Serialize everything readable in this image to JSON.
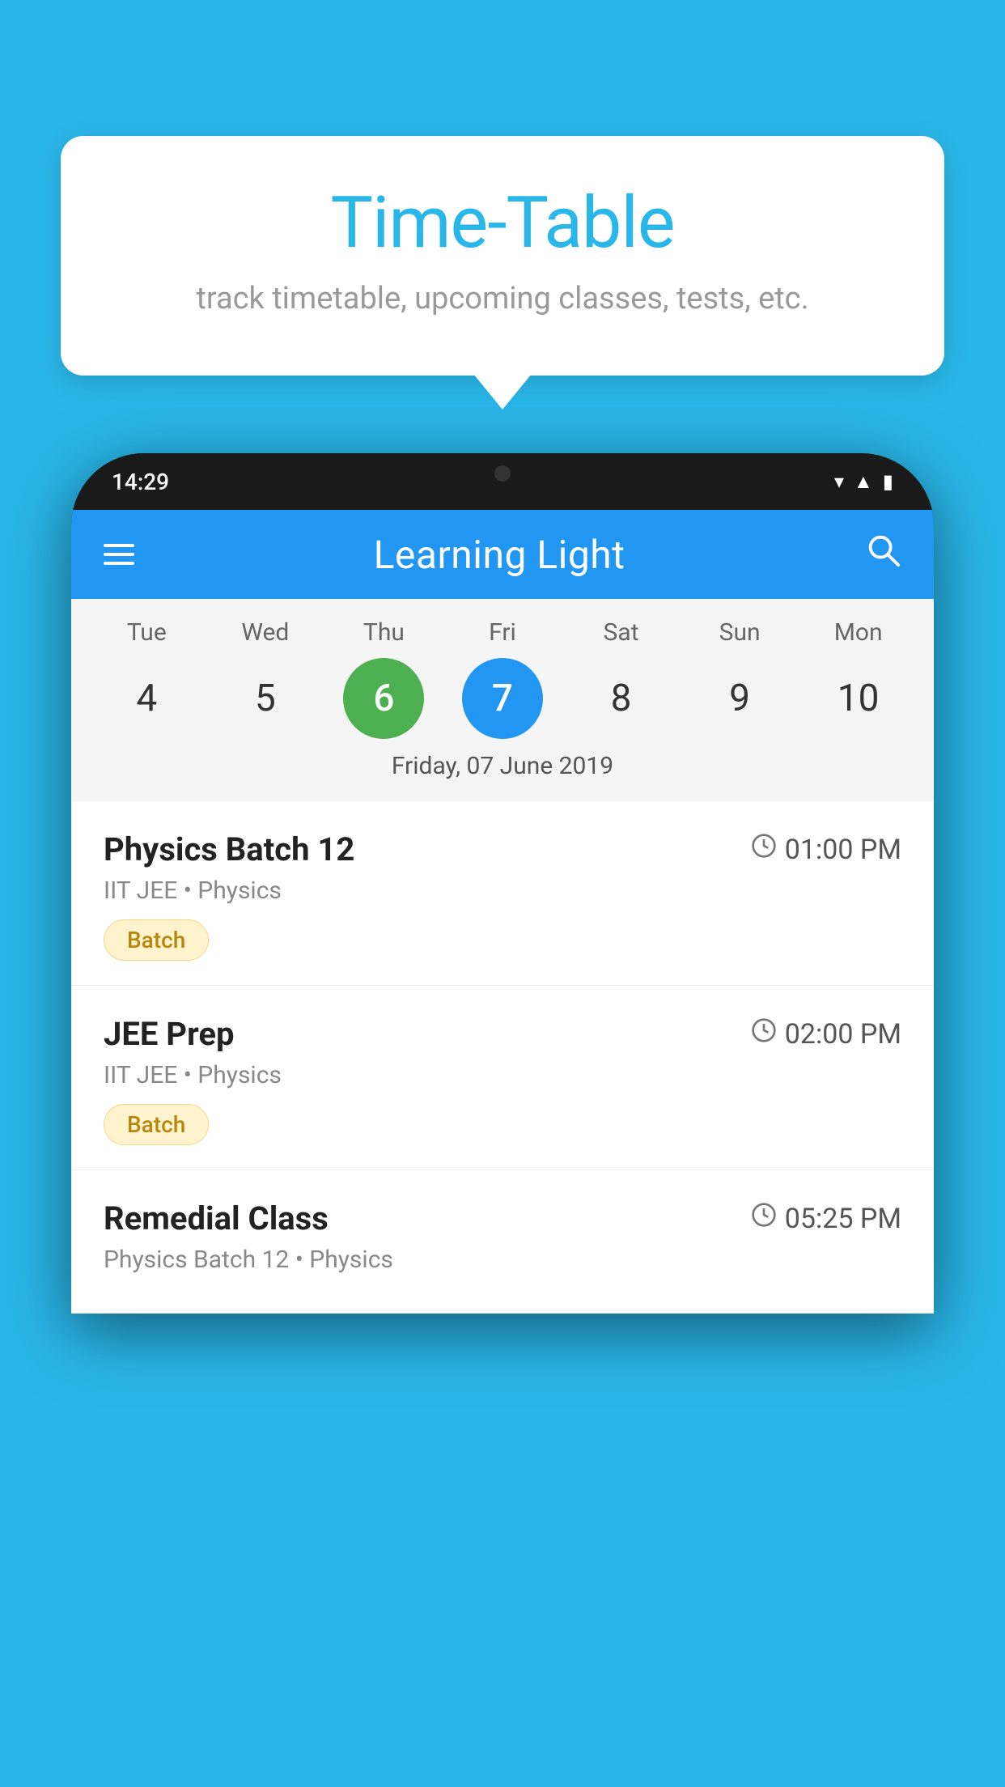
{
  "page": {
    "background_color": "#29B6E8"
  },
  "tooltip": {
    "title": "Time-Table",
    "subtitle": "track timetable, upcoming classes, tests, etc."
  },
  "phone": {
    "status_bar": {
      "time": "14:29"
    },
    "app_header": {
      "title": "Learning Light"
    },
    "calendar": {
      "days": [
        {
          "label": "Tue",
          "num": "4"
        },
        {
          "label": "Wed",
          "num": "5"
        },
        {
          "label": "Thu",
          "num": "6",
          "state": "today"
        },
        {
          "label": "Fri",
          "num": "7",
          "state": "selected"
        },
        {
          "label": "Sat",
          "num": "8"
        },
        {
          "label": "Sun",
          "num": "9"
        },
        {
          "label": "Mon",
          "num": "10"
        }
      ],
      "selected_date": "Friday, 07 June 2019"
    },
    "classes": [
      {
        "name": "Physics Batch 12",
        "time": "01:00 PM",
        "subtitle": "IIT JEE • Physics",
        "badge": "Batch"
      },
      {
        "name": "JEE Prep",
        "time": "02:00 PM",
        "subtitle": "IIT JEE • Physics",
        "badge": "Batch"
      },
      {
        "name": "Remedial Class",
        "time": "05:25 PM",
        "subtitle": "Physics Batch 12 • Physics",
        "badge": ""
      }
    ]
  },
  "icons": {
    "menu": "☰",
    "search": "🔍",
    "clock": "🕐"
  }
}
